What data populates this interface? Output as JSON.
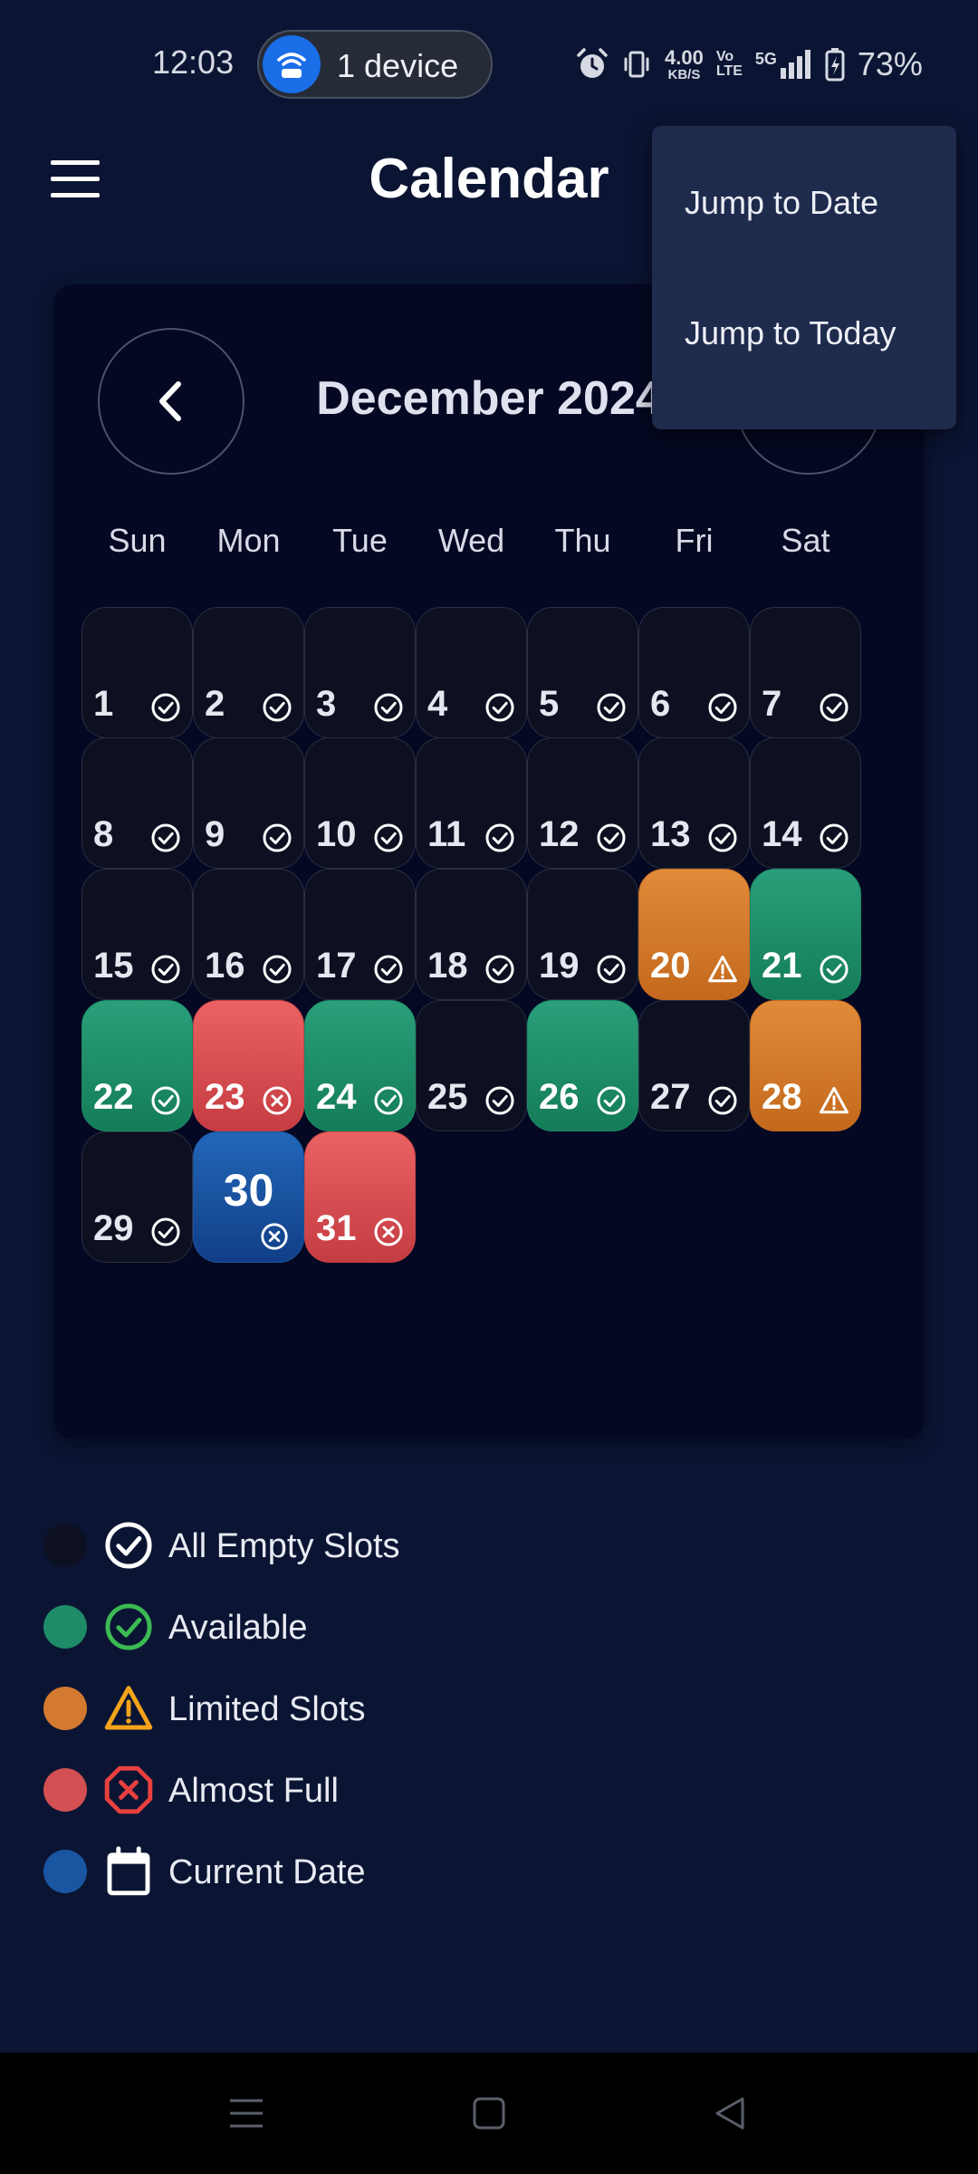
{
  "status_bar": {
    "time": "12:03",
    "hotspot_label": "1 device",
    "net_speed_value": "4.00",
    "net_speed_unit": "KB/S",
    "volte_top": "Vo",
    "volte_bottom": "LTE",
    "network_type": "5G",
    "battery_percent": "73%"
  },
  "app_bar": {
    "title": "Calendar"
  },
  "overflow_menu": {
    "items": [
      {
        "label": "Jump to Date"
      },
      {
        "label": "Jump to Today"
      }
    ]
  },
  "calendar": {
    "month_title": "December 2024",
    "weekdays": [
      "Sun",
      "Mon",
      "Tue",
      "Wed",
      "Thu",
      "Fri",
      "Sat"
    ],
    "days": [
      {
        "day": "1",
        "status": "empty"
      },
      {
        "day": "2",
        "status": "empty"
      },
      {
        "day": "3",
        "status": "empty"
      },
      {
        "day": "4",
        "status": "empty"
      },
      {
        "day": "5",
        "status": "empty"
      },
      {
        "day": "6",
        "status": "empty"
      },
      {
        "day": "7",
        "status": "empty"
      },
      {
        "day": "8",
        "status": "empty"
      },
      {
        "day": "9",
        "status": "empty"
      },
      {
        "day": "10",
        "status": "empty"
      },
      {
        "day": "11",
        "status": "empty"
      },
      {
        "day": "12",
        "status": "empty"
      },
      {
        "day": "13",
        "status": "empty"
      },
      {
        "day": "14",
        "status": "empty"
      },
      {
        "day": "15",
        "status": "empty"
      },
      {
        "day": "16",
        "status": "empty"
      },
      {
        "day": "17",
        "status": "empty"
      },
      {
        "day": "18",
        "status": "empty"
      },
      {
        "day": "19",
        "status": "empty"
      },
      {
        "day": "20",
        "status": "limited"
      },
      {
        "day": "21",
        "status": "available"
      },
      {
        "day": "22",
        "status": "available"
      },
      {
        "day": "23",
        "status": "full"
      },
      {
        "day": "24",
        "status": "available"
      },
      {
        "day": "25",
        "status": "empty"
      },
      {
        "day": "26",
        "status": "available"
      },
      {
        "day": "27",
        "status": "empty"
      },
      {
        "day": "28",
        "status": "limited"
      },
      {
        "day": "29",
        "status": "empty"
      },
      {
        "day": "30",
        "status": "current"
      },
      {
        "day": "31",
        "status": "full"
      }
    ]
  },
  "legend": [
    {
      "label": "All Empty Slots",
      "status": "empty",
      "icon": "check-circle-icon",
      "dot_color": "#0c1020",
      "icon_color": "#ffffff"
    },
    {
      "label": "Available",
      "status": "available",
      "icon": "check-circle-icon",
      "dot_color": "#1e8c68",
      "icon_color": "#3cba54"
    },
    {
      "label": "Limited Slots",
      "status": "limited",
      "icon": "warning-triangle-icon",
      "dot_color": "#d47a30",
      "icon_color": "#f5a31a"
    },
    {
      "label": "Almost Full",
      "status": "full",
      "icon": "x-octagon-icon",
      "dot_color": "#d24f52",
      "icon_color": "#e8403f"
    },
    {
      "label": "Current Date",
      "status": "current",
      "icon": "calendar-icon",
      "dot_color": "#1a55a2",
      "icon_color": "#ffffff"
    }
  ],
  "colors": {
    "background": "#0b1533",
    "card": "#040822",
    "menu": "#1f2b4d",
    "hotspot_accent": "#1a6ee8"
  }
}
